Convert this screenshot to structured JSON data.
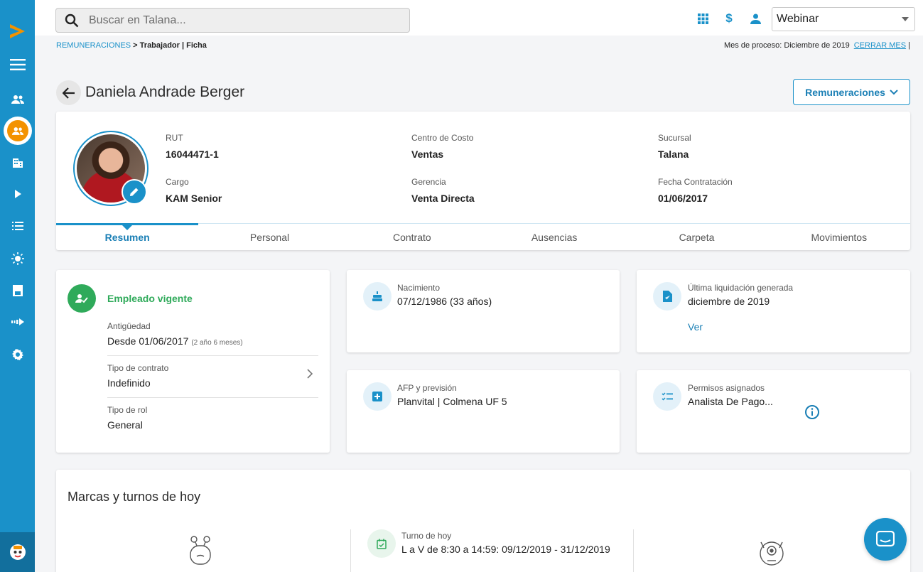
{
  "search": {
    "placeholder": "Buscar en Talana..."
  },
  "header": {
    "company": "Webinar"
  },
  "breadcrumb": {
    "root": "REMUNERACIONES",
    "sep": " > ",
    "current": "Trabajador | Ficha"
  },
  "process": {
    "label": "Mes de proceso: Diciembre de 2019",
    "close": "CERRAR MES",
    "pipe": " |"
  },
  "page": {
    "title": "Daniela Andrade Berger",
    "menu_button": "Remuneraciones"
  },
  "profile": {
    "rut_label": "RUT",
    "rut": "16044471-1",
    "cargo_label": "Cargo",
    "cargo": "KAM Senior",
    "cc_label": "Centro de Costo",
    "cc": "Ventas",
    "gerencia_label": "Gerencia",
    "gerencia": "Venta Directa",
    "sucursal_label": "Sucursal",
    "sucursal": "Talana",
    "fecha_label": "Fecha Contratación",
    "fecha": "01/06/2017"
  },
  "tabs": [
    {
      "label": "Resumen"
    },
    {
      "label": "Personal"
    },
    {
      "label": "Contrato"
    },
    {
      "label": "Ausencias"
    },
    {
      "label": "Carpeta"
    },
    {
      "label": "Movimientos"
    }
  ],
  "status": {
    "title": "Empleado vigente",
    "antiguedad_label": "Antigüedad",
    "antiguedad": "Desde 01/06/2017",
    "antiguedad_note": "(2 año 6 meses)",
    "tipo_contrato_label": "Tipo de contrato",
    "tipo_contrato": "Indefinido",
    "tipo_rol_label": "Tipo de rol",
    "tipo_rol": "General"
  },
  "nacimiento": {
    "label": "Nacimiento",
    "value": "07/12/1986 (33 años)"
  },
  "liquidacion": {
    "label": "Última liquidación generada",
    "value": "diciembre de 2019",
    "link": "Ver"
  },
  "afp": {
    "label": "AFP y previsión",
    "value": "Planvital | Colmena UF 5"
  },
  "permisos": {
    "label": "Permisos asignados",
    "value": "Analista De Pago..."
  },
  "marcas": {
    "title": "Marcas y turnos de hoy",
    "turno_label": "Turno de hoy",
    "turno_value": "L a V de 8:30 a 14:59: 09/12/2019 - 31/12/2019"
  },
  "colors": {
    "primary": "#1a91c9",
    "accent": "#f39200",
    "success": "#2faa5a"
  }
}
